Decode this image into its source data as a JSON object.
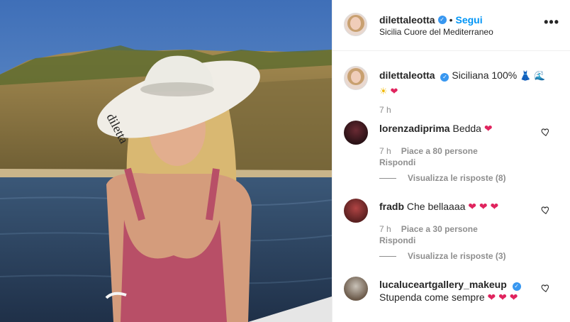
{
  "post": {
    "username": "dilettaleotta",
    "follow_label": "Segui",
    "dot": "•",
    "location": "Sicilia Cuore del Mediterraneo",
    "more": "•••",
    "photo_hat_text": "diletta"
  },
  "caption": {
    "username": "dilettaleotta",
    "text": "Siciliana 100%",
    "time": "7 h"
  },
  "comments": [
    {
      "username": "lorenzadiprima",
      "text": "Bedda",
      "time": "7 h",
      "likes": "Piace a 80 persone",
      "reply": "Rispondi",
      "view_replies": "Visualizza le risposte (8)",
      "hearts": "❤"
    },
    {
      "username": "fradb",
      "text": "Che bellaaaa",
      "time": "7 h",
      "likes": "Piace a 30 persone",
      "reply": "Rispondi",
      "view_replies": "Visualizza le risposte (3)",
      "hearts": "❤ ❤ ❤"
    },
    {
      "username": "lucaluceartgallery_makeup",
      "text": "Stupenda come sempre",
      "hearts": "❤ ❤ ❤"
    }
  ],
  "icons": {
    "verified": "verified-badge-icon",
    "more": "more-options-icon",
    "like": "heart-outline-icon"
  },
  "colors": {
    "link_blue": "#0095f6",
    "verified_blue": "#3897f0",
    "secondary_text": "#8e8e8e",
    "heart_red": "#e0245e"
  }
}
